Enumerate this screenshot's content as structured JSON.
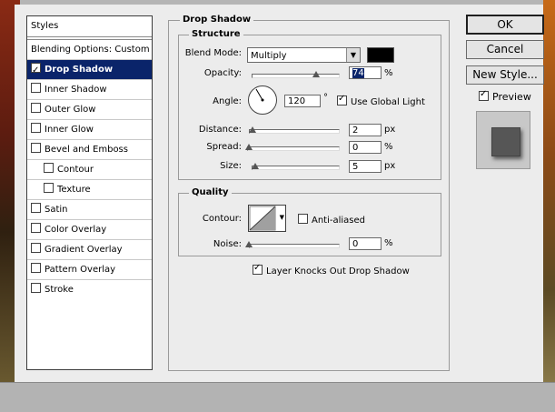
{
  "styles_panel": {
    "header": "Styles",
    "blending_options": "Blending Options: Custom",
    "items": [
      {
        "label": "Drop Shadow",
        "checked": true,
        "selected": true
      },
      {
        "label": "Inner Shadow",
        "checked": false
      },
      {
        "label": "Outer Glow",
        "checked": false
      },
      {
        "label": "Inner Glow",
        "checked": false
      },
      {
        "label": "Bevel and Emboss",
        "checked": false
      },
      {
        "label": "Contour",
        "checked": false,
        "indent": true
      },
      {
        "label": "Texture",
        "checked": false,
        "indent": true
      },
      {
        "label": "Satin",
        "checked": false
      },
      {
        "label": "Color Overlay",
        "checked": false
      },
      {
        "label": "Gradient Overlay",
        "checked": false
      },
      {
        "label": "Pattern Overlay",
        "checked": false
      },
      {
        "label": "Stroke",
        "checked": false
      }
    ]
  },
  "drop_shadow": {
    "title": "Drop Shadow",
    "structure": {
      "title": "Structure",
      "blend_mode_label": "Blend Mode:",
      "blend_mode_value": "Multiply",
      "shadow_color": "#000000",
      "opacity_label": "Opacity:",
      "opacity_value": "74",
      "opacity_unit": "%",
      "angle_label": "Angle:",
      "angle_value": "120",
      "angle_unit": "°",
      "use_global_light_label": "Use Global Light",
      "use_global_light_checked": true,
      "distance_label": "Distance:",
      "distance_value": "2",
      "distance_unit": "px",
      "spread_label": "Spread:",
      "spread_value": "0",
      "spread_unit": "%",
      "size_label": "Size:",
      "size_value": "5",
      "size_unit": "px"
    },
    "quality": {
      "title": "Quality",
      "contour_label": "Contour:",
      "anti_aliased_label": "Anti-aliased",
      "anti_aliased_checked": false,
      "noise_label": "Noise:",
      "noise_value": "0",
      "noise_unit": "%"
    },
    "layer_knocks_out_label": "Layer Knocks Out Drop Shadow",
    "layer_knocks_out_checked": true
  },
  "buttons": {
    "ok": "OK",
    "cancel": "Cancel",
    "new_style": "New Style...",
    "preview_label": "Preview",
    "preview_checked": true
  },
  "colors": {
    "selection": "#0a246a",
    "dialog_bg": "#ececec"
  }
}
